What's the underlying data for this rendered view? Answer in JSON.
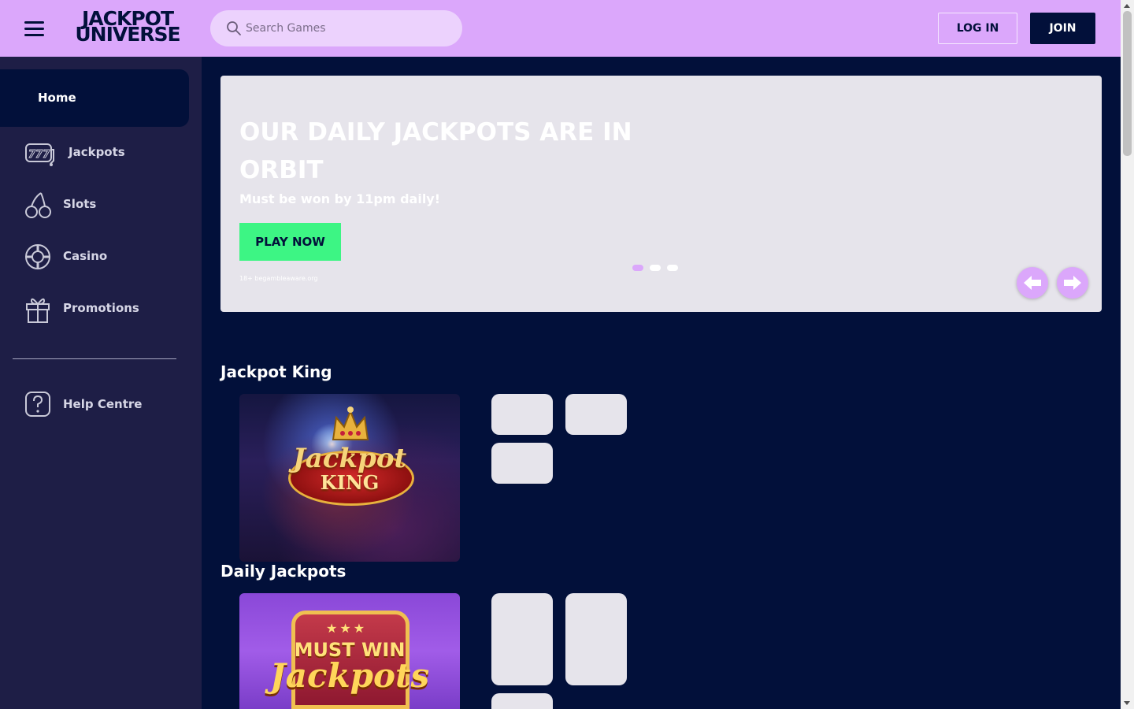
{
  "header": {
    "logo_line1": "JACKPOT",
    "logo_line2": "UNIVERSE",
    "search_placeholder": "Search Games",
    "login_label": "LOG IN",
    "join_label": "JOIN"
  },
  "sidebar": {
    "home_label": "Home",
    "items": [
      {
        "label": "Jackpots",
        "icon": "slot-machine-777-icon"
      },
      {
        "label": "Slots",
        "icon": "cherries-icon"
      },
      {
        "label": "Casino",
        "icon": "roulette-chip-icon"
      },
      {
        "label": "Promotions",
        "icon": "gift-icon"
      }
    ],
    "help_label": "Help Centre",
    "help_icon": "question-mark-icon"
  },
  "hero": {
    "title": "OUR DAILY JACKPOTS ARE IN ORBIT",
    "subtitle": "Must be won by 11pm daily!",
    "cta_label": "PLAY NOW",
    "legal": "18+ begambleaware.org",
    "slides_total": 3,
    "active_slide": 1
  },
  "sections": [
    {
      "title": "Jackpot King",
      "featured_game_title": "Jackpot King"
    },
    {
      "title": "Daily Jackpots",
      "featured_game_title": "Must Win Jackpots"
    }
  ],
  "artwork": {
    "jk_word1": "Jackpot",
    "jk_word2": "KING",
    "mw_line1": "MUST WIN",
    "mw_line2": "Jackpots"
  },
  "colors": {
    "header_bg": "#dba7fb",
    "page_bg": "#02103a",
    "sidebar_bg": "#1e1e46",
    "cta_green": "#3df584",
    "skeleton": "#e6e4eb"
  }
}
